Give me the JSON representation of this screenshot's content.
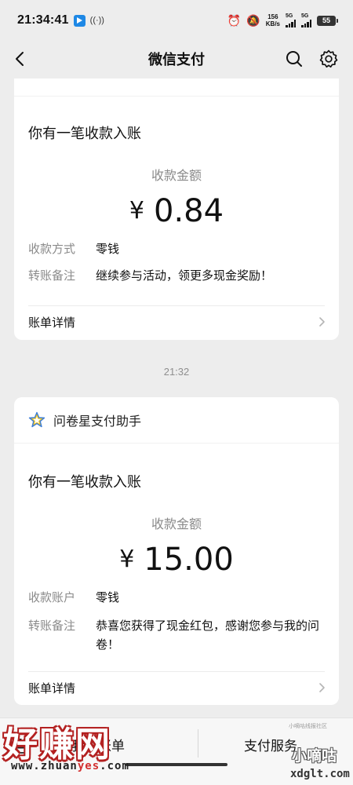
{
  "status_bar": {
    "time": "21:34:41",
    "net_speed_value": "156",
    "net_speed_unit": "KB/s",
    "sig1_label": "5G",
    "sig2_label": "5G",
    "battery": "55"
  },
  "nav": {
    "title": "微信支付"
  },
  "cards": [
    {
      "notice_title": "你有一笔收款入账",
      "amount_label": "收款金额",
      "currency": "¥",
      "amount": "0.84",
      "rows": [
        {
          "key": "收款方式",
          "value": "零钱"
        },
        {
          "key": "转账备注",
          "value": "继续参与活动，领更多现金奖励！"
        }
      ],
      "detail_label": "账单详情"
    },
    {
      "sender": "问卷星支付助手",
      "notice_title": "你有一笔收款入账",
      "amount_label": "收款金额",
      "currency": "¥",
      "amount": "15.00",
      "rows": [
        {
          "key": "收款账户",
          "value": "零钱"
        },
        {
          "key": "转账备注",
          "value": "恭喜您获得了现金红包，感谢您参与我的问卷！"
        }
      ],
      "detail_label": "账单详情"
    }
  ],
  "timestamp": "21:32",
  "bottom_tabs": {
    "left": "我的账单",
    "right": "支付服务"
  },
  "watermarks": {
    "left_main": "好赚网",
    "left_url_a": "www.zhuan",
    "left_url_b": "yes",
    "left_url_c": ".com",
    "right_top": "小嘀咕线报社区",
    "right_main": "小嘀咕",
    "right_url": "xdglt.com"
  },
  "icons": [
    "back-arrow-icon",
    "search-icon",
    "gear-icon",
    "star-icon",
    "chevron-right-icon",
    "keyboard-icon"
  ],
  "colors": {
    "page_bg": "#ededed",
    "card_bg": "#ffffff",
    "muted_text": "#8a8a8a",
    "star_yellow": "#f5c518",
    "star_blue": "#3b7dd8"
  }
}
